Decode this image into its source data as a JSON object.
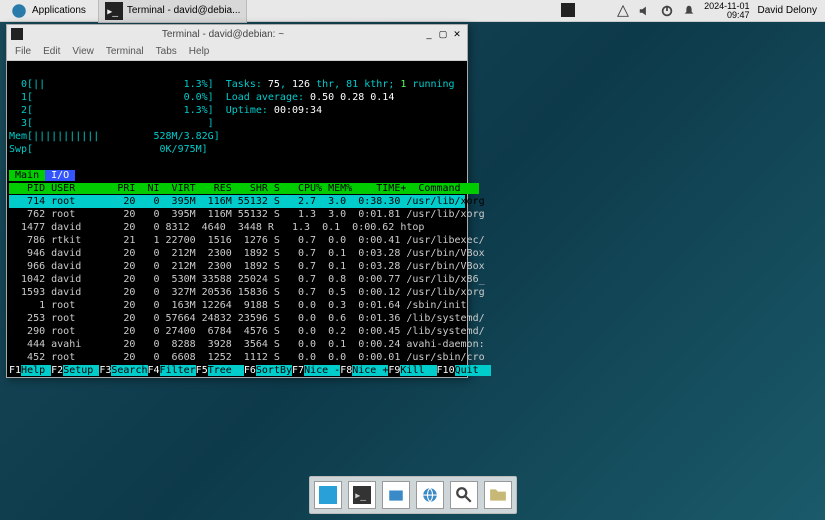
{
  "panel": {
    "apps_label": "Applications",
    "task_label": "Terminal - david@debia...",
    "clock_date": "2024-11-01",
    "clock_time": "09:47",
    "user": "David Delony"
  },
  "window": {
    "title": "Terminal - david@debian: ~",
    "menus": [
      "File",
      "Edit",
      "View",
      "Terminal",
      "Tabs",
      "Help"
    ]
  },
  "htop": {
    "cpu0": "  0[||                       1.3%]",
    "cpu1": "  1[                         0.0%]",
    "cpu2": "  2[                         1.3%]",
    "cpu3": "  3[                             ]",
    "mem": "Mem[|||||||||||         528M/3.82G]",
    "swp": "Swp[                     0K/975M]",
    "tasks_pre": "Tasks: ",
    "tasks_n1": "75",
    "tasks_mid": ", ",
    "tasks_n2": "126",
    "tasks_post": " thr, 81 kthr; ",
    "tasks_run": "1",
    "tasks_run_lbl": " running",
    "load_lbl": "Load average: ",
    "load_vals": "0.50 0.28 0.14",
    "uptime_lbl": "Uptime: ",
    "uptime_val": "00:09:34",
    "tab_main": " Main ",
    "tab_io": " I/O ",
    "header": "   PID USER       PRI  NI  VIRT   RES   SHR S   CPU% MEM%    TIME+  Command   ",
    "rows": [
      {
        "sel": true,
        "t": "   714 root        20   0  395M  116M 55132 S   2.7  3.0  0:38.30 /usr/lib/xorg"
      },
      {
        "sel": false,
        "t": "   762 root        20   0  395M  116M 55132 S   1.3  3.0  0:01.81 /usr/lib/xorg",
        "cmd_cyan": true
      },
      {
        "sel": false,
        "t": "  1477 david       20   0 8312  4640  3448 R   1.3  0.1  0:00.62 htop"
      },
      {
        "sel": false,
        "t": "   786 rtkit       21   1 22700  1516  1276 S   0.7  0.0  0:00.41 /usr/libexec/"
      },
      {
        "sel": false,
        "t": "   946 david       20   0  212M  2300  1892 S   0.7  0.1  0:03.28 /usr/bin/VBox",
        "cmd_cyan": true
      },
      {
        "sel": false,
        "t": "   966 david       20   0  212M  2300  1892 S   0.7  0.1  0:03.28 /usr/bin/VBox",
        "cmd_cyan": true
      },
      {
        "sel": false,
        "t": "  1042 david       20   0  530M 33588 25024 S   0.7  0.8  0:00.77 /usr/lib/x86_"
      },
      {
        "sel": false,
        "t": "  1593 david       20   0  327M 20536 15836 S   0.7  0.5  0:00.12 /usr/lib/xorg"
      },
      {
        "sel": false,
        "t": "     1 root        20   0  163M 12264  9188 S   0.0  0.3  0:01.64 /sbin/init"
      },
      {
        "sel": false,
        "t": "   253 root        20   0 57664 24832 23596 S   0.0  0.6  0:01.36 /lib/systemd/"
      },
      {
        "sel": false,
        "t": "   290 root        20   0 27400  6784  4576 S   0.0  0.2  0:00.45 /lib/systemd/"
      },
      {
        "sel": false,
        "t": "   444 avahi       20   0  8288  3928  3564 S   0.0  0.1  0:00.24 avahi-daemon:"
      },
      {
        "sel": false,
        "t": "   452 root        20   0  6608  1252  1112 S   0.0  0.0  0:00.01 /usr/sbin/cro"
      }
    ],
    "fkeys": [
      {
        "k": "F1",
        "l": "Help "
      },
      {
        "k": "F2",
        "l": "Setup "
      },
      {
        "k": "F3",
        "l": "Search"
      },
      {
        "k": "F4",
        "l": "Filter"
      },
      {
        "k": "F5",
        "l": "Tree  "
      },
      {
        "k": "F6",
        "l": "SortBy"
      },
      {
        "k": "F7",
        "l": "Nice -"
      },
      {
        "k": "F8",
        "l": "Nice +"
      },
      {
        "k": "F9",
        "l": "Kill  "
      },
      {
        "k": "F10",
        "l": "Quit  "
      }
    ]
  },
  "dock_items": [
    "desktop",
    "terminal",
    "files",
    "web",
    "search",
    "folder"
  ]
}
